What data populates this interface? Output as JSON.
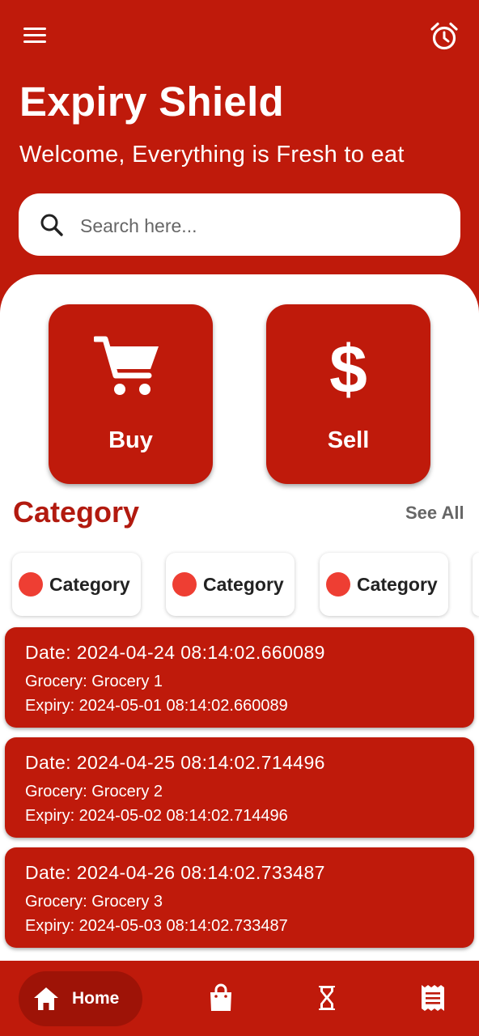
{
  "header": {
    "app_title": "Expiry Shield",
    "welcome": "Welcome, Everything is Fresh to eat",
    "menu_icon": "hamburger-menu-icon",
    "alarm_icon": "alarm-clock-icon"
  },
  "search": {
    "placeholder": "Search here...",
    "value": "",
    "icon": "search-icon"
  },
  "actions": {
    "buy": {
      "label": "Buy",
      "icon": "shopping-cart-icon"
    },
    "sell": {
      "label": "Sell",
      "icon": "$"
    }
  },
  "category": {
    "title": "Category",
    "see_all": "See All",
    "chips": [
      {
        "label": "Category"
      },
      {
        "label": "Category"
      },
      {
        "label": "Category"
      }
    ]
  },
  "records": [
    {
      "date": "Date: 2024-04-24 08:14:02.660089",
      "grocery": "Grocery: Grocery 1",
      "expiry": "Expiry: 2024-05-01 08:14:02.660089"
    },
    {
      "date": "Date: 2024-04-25 08:14:02.714496",
      "grocery": "Grocery: Grocery 2",
      "expiry": "Expiry: 2024-05-02 08:14:02.714496"
    },
    {
      "date": "Date: 2024-04-26 08:14:02.733487",
      "grocery": "Grocery: Grocery 3",
      "expiry": "Expiry: 2024-05-03 08:14:02.733487"
    }
  ],
  "bottom_nav": {
    "home_label": "Home",
    "items": [
      "home-icon",
      "shopping-bag-icon",
      "hourglass-icon",
      "receipt-icon"
    ]
  },
  "colors": {
    "primary": "#BF1A0B",
    "primary_dark": "#9E1307",
    "category_title": "#B21A0F",
    "chip_dot": "#EE3E33",
    "surface": "#FFFFFF"
  }
}
